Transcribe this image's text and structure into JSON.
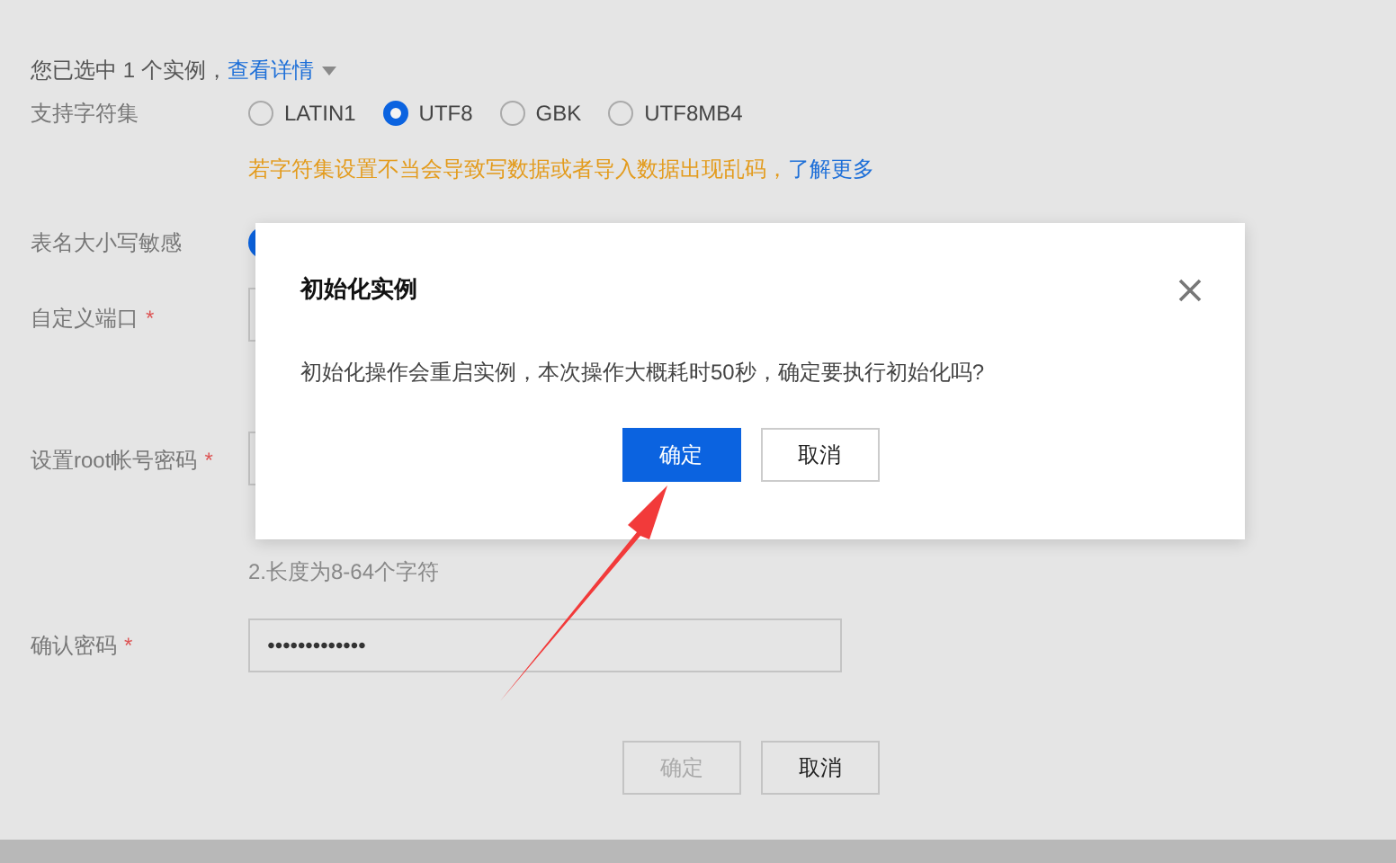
{
  "selection": {
    "prefix": "您已选中 1 个实例，",
    "link": "查看详情"
  },
  "form": {
    "charset": {
      "label": "支持字符集",
      "options": [
        {
          "label": "LATIN1",
          "selected": false
        },
        {
          "label": "UTF8",
          "selected": true
        },
        {
          "label": "GBK",
          "selected": false
        },
        {
          "label": "UTF8MB4",
          "selected": false
        }
      ],
      "warning": "若字符集设置不当会导致写数据或者导入数据出现乱码，",
      "warning_link": "了解更多"
    },
    "case_sensitive": {
      "label": "表名大小写敏感",
      "on": true
    },
    "port": {
      "label": "自定义端口",
      "required_mark": "*"
    },
    "root_password": {
      "label": "设置root帐号密码",
      "required_mark": "*",
      "hint": "2.长度为8-64个字符"
    },
    "confirm_password": {
      "label": "确认密码",
      "required_mark": "*",
      "value": "•••••••••••••"
    },
    "buttons": [
      {
        "label": "确定",
        "disabled": true
      },
      {
        "label": "取消",
        "disabled": false
      }
    ]
  },
  "dialog": {
    "title": "初始化实例",
    "message": "初始化操作会重启实例，本次操作大概耗时50秒，确定要执行初始化吗?",
    "buttons": [
      {
        "label": "确定",
        "kind": "primary"
      },
      {
        "label": "取消",
        "kind": "default"
      }
    ]
  }
}
